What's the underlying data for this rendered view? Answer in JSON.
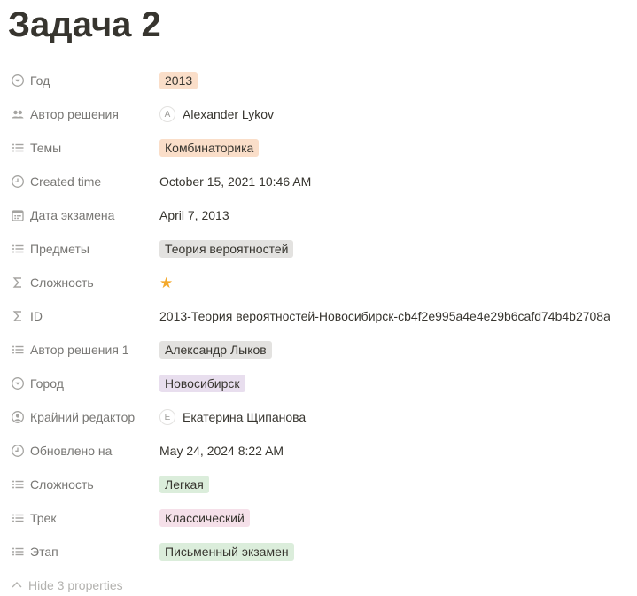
{
  "page": {
    "title": "Задача 2"
  },
  "colors": {
    "tag_orange": "#fadec9",
    "tag_gray": "#e3e2e0",
    "tag_purple": "#e8deee",
    "tag_green": "#dbeddb",
    "tag_pink": "#f5e0e9",
    "star": "#f4a92b"
  },
  "properties": [
    {
      "name": "Год",
      "icon": "select-icon",
      "kind": "tag",
      "value": "2013",
      "color": "#fadec9"
    },
    {
      "name": "Автор решения",
      "icon": "people-icon",
      "kind": "person",
      "avatar": "A",
      "value": "Alexander Lykov"
    },
    {
      "name": "Темы",
      "icon": "list-icon",
      "kind": "tag",
      "value": "Комбинаторика",
      "color": "#fadec9"
    },
    {
      "name": "Created time",
      "icon": "clock-icon",
      "kind": "text",
      "value": "October 15, 2021 10:46 AM"
    },
    {
      "name": "Дата экзамена",
      "icon": "calendar-icon",
      "kind": "text",
      "value": "April 7, 2013"
    },
    {
      "name": "Предметы",
      "icon": "list-icon",
      "kind": "tag",
      "value": "Теория вероятностей",
      "color": "#e3e2e0"
    },
    {
      "name": "Сложность",
      "icon": "sigma-icon",
      "kind": "star",
      "value": "★"
    },
    {
      "name": "ID",
      "icon": "sigma-icon",
      "kind": "text",
      "value": "2013-Теория вероятностей-Новосибирск-cb4f2e995a4e4e29b6cafd74b4b2708a"
    },
    {
      "name": "Автор решения 1",
      "icon": "list-icon",
      "kind": "tag",
      "value": "Александр Лыков",
      "color": "#e3e2e0"
    },
    {
      "name": "Город",
      "icon": "select-icon",
      "kind": "tag",
      "value": "Новосибирск",
      "color": "#e8deee"
    },
    {
      "name": "Крайний редактор",
      "icon": "person-circle-icon",
      "kind": "person",
      "avatar": "E",
      "value": "Екатерина Щипанова"
    },
    {
      "name": "Обновлено на",
      "icon": "clock-icon",
      "kind": "text",
      "value": "May 24, 2024 8:22 AM"
    },
    {
      "name": "Сложность",
      "icon": "list-icon",
      "kind": "tag",
      "value": "Легкая",
      "color": "#dbeddb"
    },
    {
      "name": "Трек",
      "icon": "list-icon",
      "kind": "tag",
      "value": "Классический",
      "color": "#f5e0e9"
    },
    {
      "name": "Этап",
      "icon": "list-icon",
      "kind": "tag",
      "value": "Письменный экзамен",
      "color": "#dbeddb"
    }
  ],
  "hide_properties_label": "Hide 3 properties"
}
